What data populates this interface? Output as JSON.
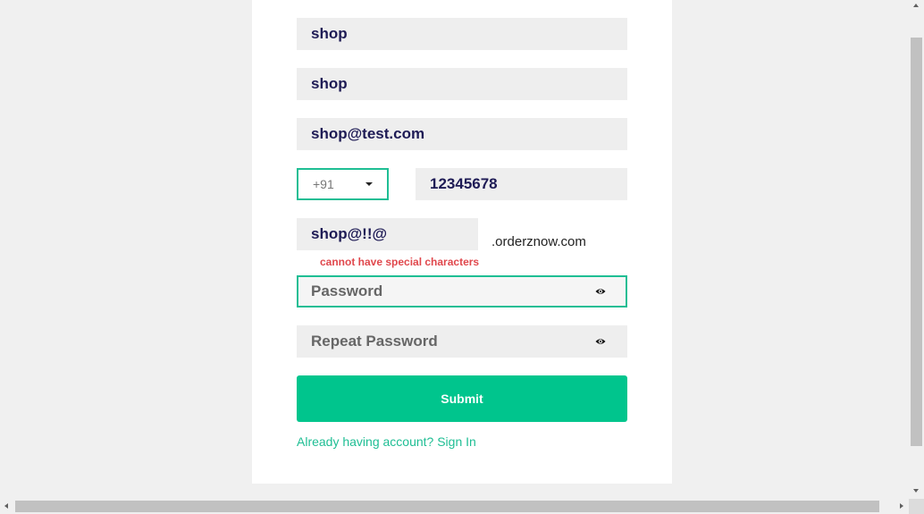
{
  "form": {
    "first_name": "shop",
    "last_name": "shop",
    "email": "shop@test.com",
    "country_code": "+91",
    "phone": "12345678",
    "subdomain": "shop@!!@",
    "domain_suffix": ".orderznow.com",
    "subdomain_error": "cannot have special characters",
    "password_placeholder": "Password",
    "repeat_password_placeholder": "Repeat Password",
    "submit_label": "Submit",
    "signin_link": "Already having account? Sign In"
  },
  "colors": {
    "accent": "#00c58d",
    "error": "#e0484d",
    "text": "#1e1b55"
  },
  "icons": {
    "password_toggle": "eye-icon",
    "dropdown": "chevron-down-icon"
  }
}
